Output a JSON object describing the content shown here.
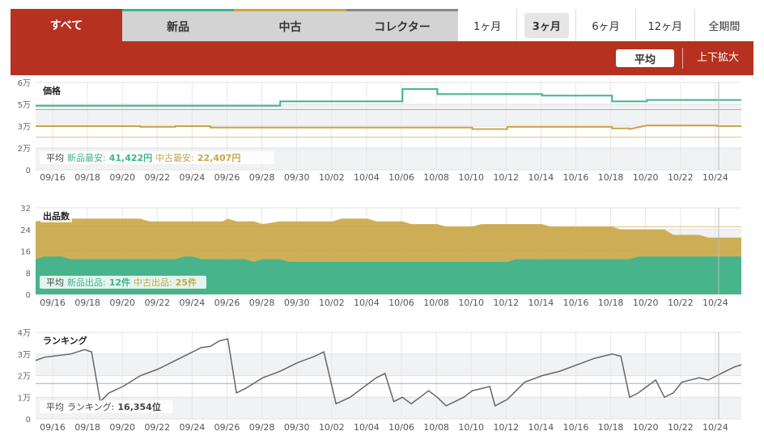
{
  "tabs": [
    {
      "label": "すべて",
      "active": true
    },
    {
      "label": "新品",
      "active": false
    },
    {
      "label": "中古",
      "active": false
    },
    {
      "label": "コレクター",
      "active": false
    }
  ],
  "periods": [
    "1ヶ月",
    "3ヶ月",
    "6ヶ月",
    "12ヶ月",
    "全期間"
  ],
  "active_period": "3ヶ月",
  "toolbar": {
    "average_label": "平均",
    "zoom_label": "上下拡大"
  },
  "colors": {
    "brand": "#b6311f",
    "new": "#3fb48f",
    "used": "#c9a646",
    "rank": "#666666"
  },
  "chart_data": [
    {
      "type": "line",
      "title": "価格",
      "x_ticks": [
        "09/16",
        "09/18",
        "09/20",
        "09/22",
        "09/24",
        "09/26",
        "09/28",
        "09/30",
        "10/02",
        "10/04",
        "10/06",
        "10/08",
        "10/10",
        "10/12",
        "10/14",
        "10/16",
        "10/18",
        "10/20",
        "10/22",
        "10/24"
      ],
      "y_ticks": [
        "6万",
        "5万",
        "3万",
        "2万",
        "0"
      ],
      "ylim": [
        0,
        60000
      ],
      "x_range": [
        0,
        40.4
      ],
      "series": [
        {
          "name": "新品最安",
          "color": "#3fb48f",
          "points": [
            [
              0,
              44000
            ],
            [
              9,
              44000
            ],
            [
              14,
              44000
            ],
            [
              14,
              47000
            ],
            [
              21,
              47000
            ],
            [
              21,
              55500
            ],
            [
              23,
              55500
            ],
            [
              23,
              52000
            ],
            [
              29,
              52000
            ],
            [
              29,
              51000
            ],
            [
              33,
              51000
            ],
            [
              33,
              47000
            ],
            [
              35,
              47000
            ],
            [
              35,
              48000
            ],
            [
              40.4,
              48000
            ]
          ]
        },
        {
          "name": "中古最安",
          "color": "#c9a646",
          "points": [
            [
              0,
              30000
            ],
            [
              6,
              30000
            ],
            [
              6,
              29500
            ],
            [
              8,
              29500
            ],
            [
              8,
              30000
            ],
            [
              10,
              30000
            ],
            [
              10,
              29000
            ],
            [
              15,
              29000
            ],
            [
              20,
              29000
            ],
            [
              25,
              29000
            ],
            [
              25,
              28000
            ],
            [
              27,
              28000
            ],
            [
              27,
              29500
            ],
            [
              33,
              29500
            ],
            [
              33,
              28500
            ],
            [
              34,
              28500
            ],
            [
              34,
              28000
            ],
            [
              35,
              30500
            ],
            [
              39,
              30500
            ],
            [
              39,
              30000
            ],
            [
              40.4,
              30000
            ]
          ]
        }
      ],
      "averages": [
        {
          "color": "#3fb48f",
          "value": 41422
        },
        {
          "color": "#c9a646",
          "value": 22407
        }
      ],
      "legend": {
        "prefix": "平均",
        "items": [
          {
            "label": "新品最安:",
            "value": "41,422円",
            "color": "#3fb48f"
          },
          {
            "label": "中古最安:",
            "value": "22,407円",
            "color": "#c9a646"
          }
        ]
      }
    },
    {
      "type": "area",
      "title": "出品数",
      "x_ticks": [
        "09/16",
        "09/18",
        "09/20",
        "09/22",
        "09/24",
        "09/26",
        "09/28",
        "09/30",
        "10/02",
        "10/04",
        "10/06",
        "10/08",
        "10/10",
        "10/12",
        "10/14",
        "10/16",
        "10/18",
        "10/20",
        "10/22",
        "10/24"
      ],
      "y_ticks": [
        "32",
        "24",
        "16",
        "8",
        "0"
      ],
      "ylim": [
        0,
        32
      ],
      "x_range": [
        0,
        40.4
      ],
      "series": [
        {
          "name": "中古出品",
          "color": "#c9a646",
          "points": [
            [
              0,
              27
            ],
            [
              1,
              28
            ],
            [
              6,
              28
            ],
            [
              6.5,
              27
            ],
            [
              10,
              27
            ],
            [
              10.7,
              27
            ],
            [
              11,
              28
            ],
            [
              11.5,
              27
            ],
            [
              12.5,
              27
            ],
            [
              13,
              26
            ],
            [
              14,
              27
            ],
            [
              17,
              27
            ],
            [
              17.5,
              28
            ],
            [
              19,
              28
            ],
            [
              19.5,
              27
            ],
            [
              21,
              27
            ],
            [
              21.5,
              26
            ],
            [
              23,
              26
            ],
            [
              23.5,
              25
            ],
            [
              25,
              25
            ],
            [
              25.5,
              26
            ],
            [
              29,
              26
            ],
            [
              29.5,
              25
            ],
            [
              33,
              25
            ],
            [
              33.5,
              24
            ],
            [
              36,
              24
            ],
            [
              36.5,
              22
            ],
            [
              38,
              22
            ],
            [
              38.5,
              21
            ],
            [
              40.4,
              21
            ],
            [
              40.4,
              20
            ]
          ]
        },
        {
          "name": "新品出品",
          "color": "#3fb48f",
          "points": [
            [
              0,
              13
            ],
            [
              0.5,
              14
            ],
            [
              1.5,
              14
            ],
            [
              2,
              13
            ],
            [
              8,
              13
            ],
            [
              8.5,
              14
            ],
            [
              9,
              14
            ],
            [
              9.5,
              13
            ],
            [
              12,
              13
            ],
            [
              12.5,
              12
            ],
            [
              13,
              13
            ],
            [
              14,
              13
            ],
            [
              14.5,
              12
            ],
            [
              27,
              12
            ],
            [
              27.5,
              13
            ],
            [
              34,
              13
            ],
            [
              34.5,
              14
            ],
            [
              40.4,
              14
            ]
          ]
        }
      ],
      "averages": [
        {
          "color": "#c9a646",
          "value": 25
        }
      ],
      "legend": {
        "prefix": "平均",
        "items": [
          {
            "label": "新品出品:",
            "value": "12件",
            "color": "#3fb48f"
          },
          {
            "label": "中古出品:",
            "value": "25件",
            "color": "#c9a646"
          }
        ]
      }
    },
    {
      "type": "line",
      "title": "ランキング",
      "x_ticks": [
        "09/16",
        "09/18",
        "09/20",
        "09/22",
        "09/24",
        "09/26",
        "09/28",
        "09/30",
        "10/02",
        "10/04",
        "10/06",
        "10/08",
        "10/10",
        "10/12",
        "10/14",
        "10/16",
        "10/18",
        "10/20",
        "10/22",
        "10/24"
      ],
      "y_ticks": [
        "4万",
        "3万",
        "2万",
        "1万",
        "0"
      ],
      "ylim": [
        0,
        40000
      ],
      "x_range": [
        0,
        40.4
      ],
      "series": [
        {
          "name": "ランキング",
          "color": "#666666",
          "points": [
            [
              0,
              27000
            ],
            [
              0.5,
              28500
            ],
            [
              2,
              30000
            ],
            [
              2.8,
              32000
            ],
            [
              3.2,
              31000
            ],
            [
              3.7,
              8000
            ],
            [
              4.2,
              12000
            ],
            [
              5,
              15000
            ],
            [
              6,
              20000
            ],
            [
              7,
              23000
            ],
            [
              8,
              27000
            ],
            [
              9,
              31000
            ],
            [
              9.5,
              33000
            ],
            [
              10,
              33500
            ],
            [
              10.5,
              36000
            ],
            [
              11,
              37000
            ],
            [
              11.5,
              12000
            ],
            [
              12,
              14000
            ],
            [
              13,
              19000
            ],
            [
              14,
              22000
            ],
            [
              15,
              26000
            ],
            [
              16,
              29000
            ],
            [
              16.5,
              31000
            ],
            [
              17.2,
              7000
            ],
            [
              18,
              10000
            ],
            [
              19,
              16000
            ],
            [
              19.5,
              19000
            ],
            [
              20,
              21000
            ],
            [
              20.5,
              8000
            ],
            [
              21,
              10000
            ],
            [
              21.5,
              7000
            ],
            [
              22,
              10000
            ],
            [
              22.5,
              13000
            ],
            [
              23,
              10000
            ],
            [
              23.5,
              6000
            ],
            [
              24.5,
              10000
            ],
            [
              25,
              13000
            ],
            [
              25.5,
              14000
            ],
            [
              26,
              15000
            ],
            [
              26.3,
              6000
            ],
            [
              27,
              9000
            ],
            [
              27.5,
              13000
            ],
            [
              28,
              17000
            ],
            [
              29,
              20000
            ],
            [
              30,
              22000
            ],
            [
              31,
              25000
            ],
            [
              32,
              28000
            ],
            [
              33,
              30000
            ],
            [
              33.5,
              29000
            ],
            [
              34,
              10000
            ],
            [
              34.5,
              12000
            ],
            [
              35,
              15000
            ],
            [
              35.5,
              18000
            ],
            [
              36,
              10000
            ],
            [
              36.5,
              12000
            ],
            [
              37,
              17000
            ],
            [
              38,
              19000
            ],
            [
              38.5,
              18000
            ],
            [
              39,
              20000
            ],
            [
              39.5,
              22000
            ],
            [
              40,
              24000
            ],
            [
              40.4,
              25000
            ]
          ]
        }
      ],
      "averages": [
        {
          "color": "#888888",
          "value": 16354
        }
      ],
      "legend": {
        "prefix": "平均",
        "items": [
          {
            "label": "ランキング:",
            "value": "16,354位",
            "color": "#444444"
          }
        ]
      }
    }
  ]
}
